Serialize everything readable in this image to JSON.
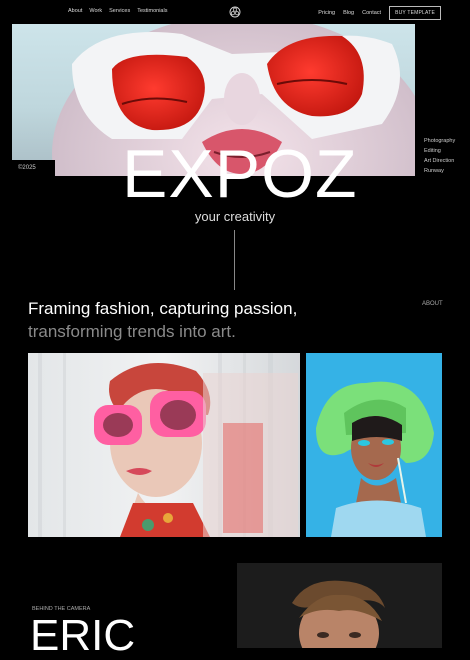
{
  "nav": {
    "left": [
      "About",
      "Work",
      "Services",
      "Testimonials"
    ],
    "right": [
      "Pricing",
      "Blog",
      "Contact"
    ],
    "cta": "BUY TEMPLATE"
  },
  "hero": {
    "title": "EXPOZ",
    "tagline": "your creativity",
    "year": "©2025",
    "services": [
      "Photography",
      "Editing",
      "Art Direction",
      "Runway"
    ]
  },
  "intro": {
    "headline_line1": "Framing fashion, capturing passion,",
    "headline_line2": "transforming trends into art.",
    "about_link": "ABOUT"
  },
  "profile": {
    "label": "BEHIND THE CAMERA",
    "name": "ERIC"
  },
  "colors": {
    "background": "#000000",
    "text": "#ffffff",
    "muted_text": "#8a8a8a",
    "accent_blue": "#35b2e6",
    "accent_red": "#e3242b",
    "accent_pink": "#ff5fa2",
    "accent_green": "#7be07a"
  }
}
